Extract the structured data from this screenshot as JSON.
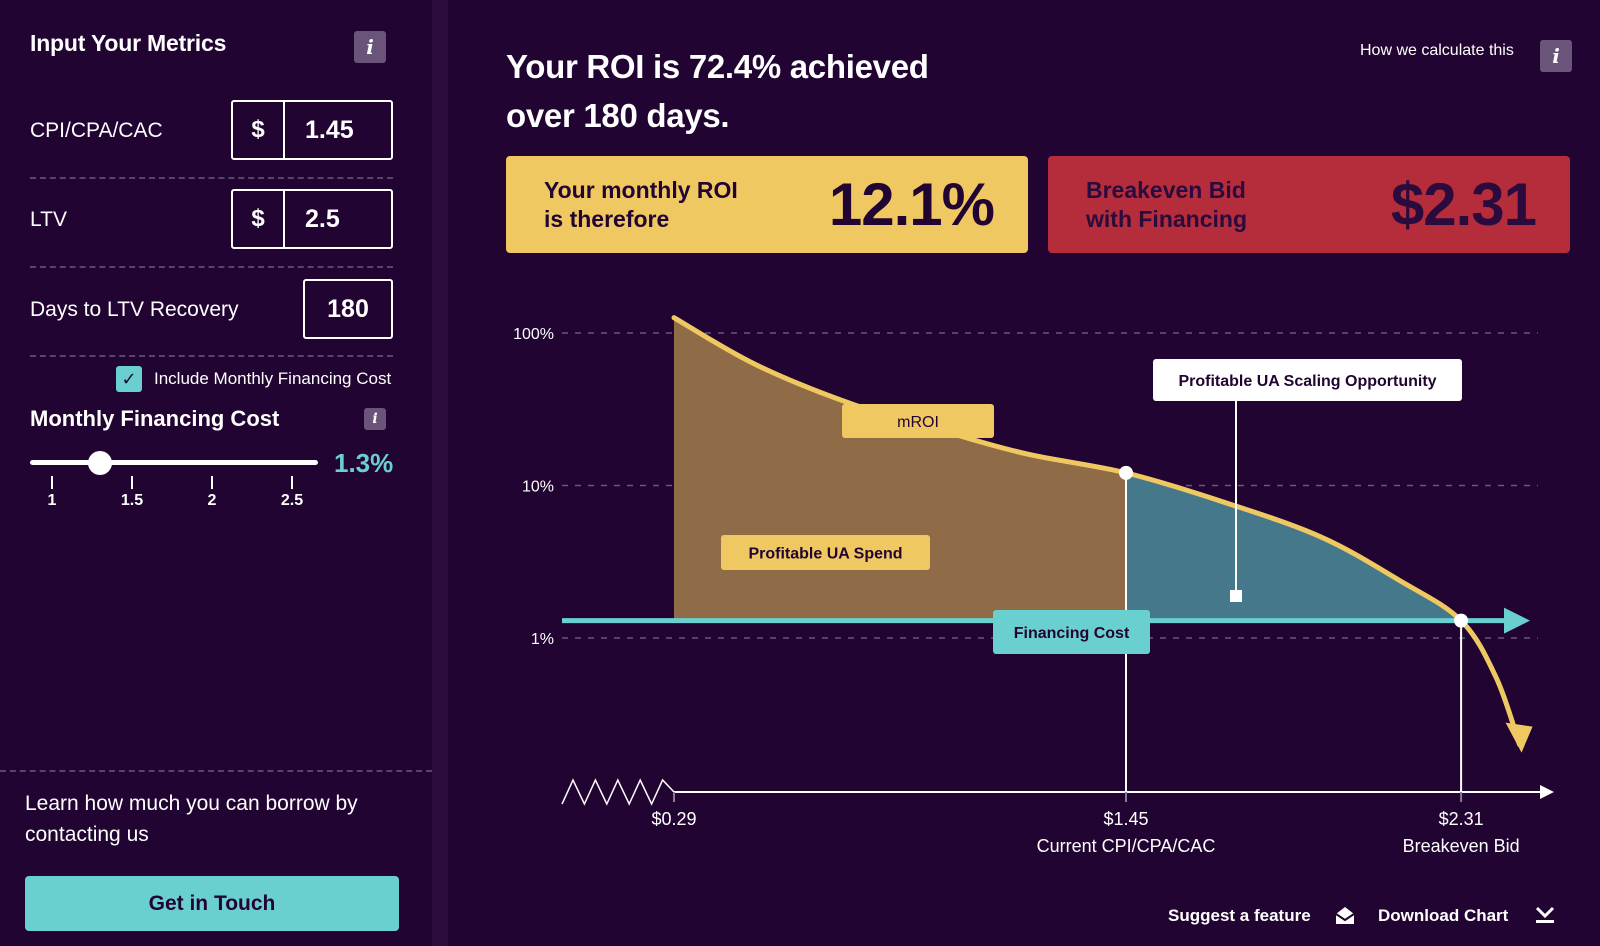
{
  "sidebar": {
    "title": "Input Your Metrics",
    "info_icon": "i",
    "metrics": [
      {
        "label": "CPI/CPA/CAC",
        "prefix": "$",
        "value": "1.45"
      },
      {
        "label": "LTV",
        "prefix": "$",
        "value": "2.5"
      },
      {
        "label": "Days to LTV Recovery",
        "prefix": "",
        "value": "180"
      }
    ],
    "include_financing": {
      "checked": true,
      "check_glyph": "✓",
      "label": "Include Monthly Financing Cost"
    },
    "financing": {
      "title": "Monthly Financing Cost",
      "value_label": "1.3%",
      "value": 1.3,
      "min": 1,
      "max": 2.75,
      "ticks": [
        "1",
        "1.5",
        "2",
        "2.5"
      ]
    },
    "borrow_text": "Learn how much you can borrow by contacting us",
    "cta_label": "Get in Touch"
  },
  "main": {
    "headline_line1": "Your ROI is 72.4% achieved",
    "headline_line2": "over 180 days.",
    "how_calc_label": "How we calculate this",
    "cards": {
      "roi_label_line1": "Your monthly ROI",
      "roi_label_line2": "is therefore",
      "roi_value": "12.1%",
      "breakeven_label_line1": "Breakeven Bid",
      "breakeven_label_line2": "with Financing",
      "breakeven_value": "$2.31"
    },
    "footer": {
      "suggest_label": "Suggest a feature",
      "download_label": "Download Chart"
    }
  },
  "colors": {
    "background": "#210431",
    "accent_teal": "#6ad0cf",
    "accent_yellow": "#f0c862",
    "accent_red": "#b52c3b",
    "area_profitable": "#8f6c47",
    "area_opportunity": "#45788a"
  },
  "chart_data": {
    "type": "area",
    "title": "",
    "xlabel": "CPI/CPA/CAC ($)",
    "ylabel": "mROI",
    "y_scale": "log",
    "ylim": [
      0.5,
      150
    ],
    "y_ticks": [
      {
        "value": 100,
        "label": "100%"
      },
      {
        "value": 10,
        "label": "10%"
      },
      {
        "value": 1,
        "label": "1%"
      }
    ],
    "x_ticks": [
      {
        "value": 0.29,
        "label": "$0.29",
        "sublabel": ""
      },
      {
        "value": 1.45,
        "label": "$1.45",
        "sublabel": "Current CPI/CPA/CAC"
      },
      {
        "value": 2.31,
        "label": "$2.31",
        "sublabel": "Breakeven Bid"
      }
    ],
    "grid": true,
    "series": [
      {
        "name": "mROI",
        "x": [
          0.29,
          0.5,
          0.75,
          1.0,
          1.2,
          1.45,
          1.7,
          1.95,
          2.15,
          2.31,
          2.4,
          2.46
        ],
        "y": [
          126,
          62,
          34,
          22,
          16,
          12.1,
          7.8,
          4.6,
          2.4,
          1.3,
          0.55,
          0.2
        ]
      },
      {
        "name": "Financing Cost",
        "constant_y": 1.3
      }
    ],
    "regions": [
      {
        "name": "Profitable UA Spend",
        "x_from": 0.29,
        "x_to": 1.45
      },
      {
        "name": "Profitable UA Scaling Opportunity",
        "x_from": 1.45,
        "x_to": 2.31
      }
    ],
    "markers": [
      {
        "x": 1.45,
        "y": 12.1
      },
      {
        "x": 2.31,
        "y": 1.3
      }
    ],
    "annotations": {
      "mroi_label": "mROI",
      "profitable_spend": "Profitable UA Spend",
      "scaling_opportunity": "Profitable UA Scaling Opportunity",
      "financing_cost": "Financing Cost"
    }
  }
}
